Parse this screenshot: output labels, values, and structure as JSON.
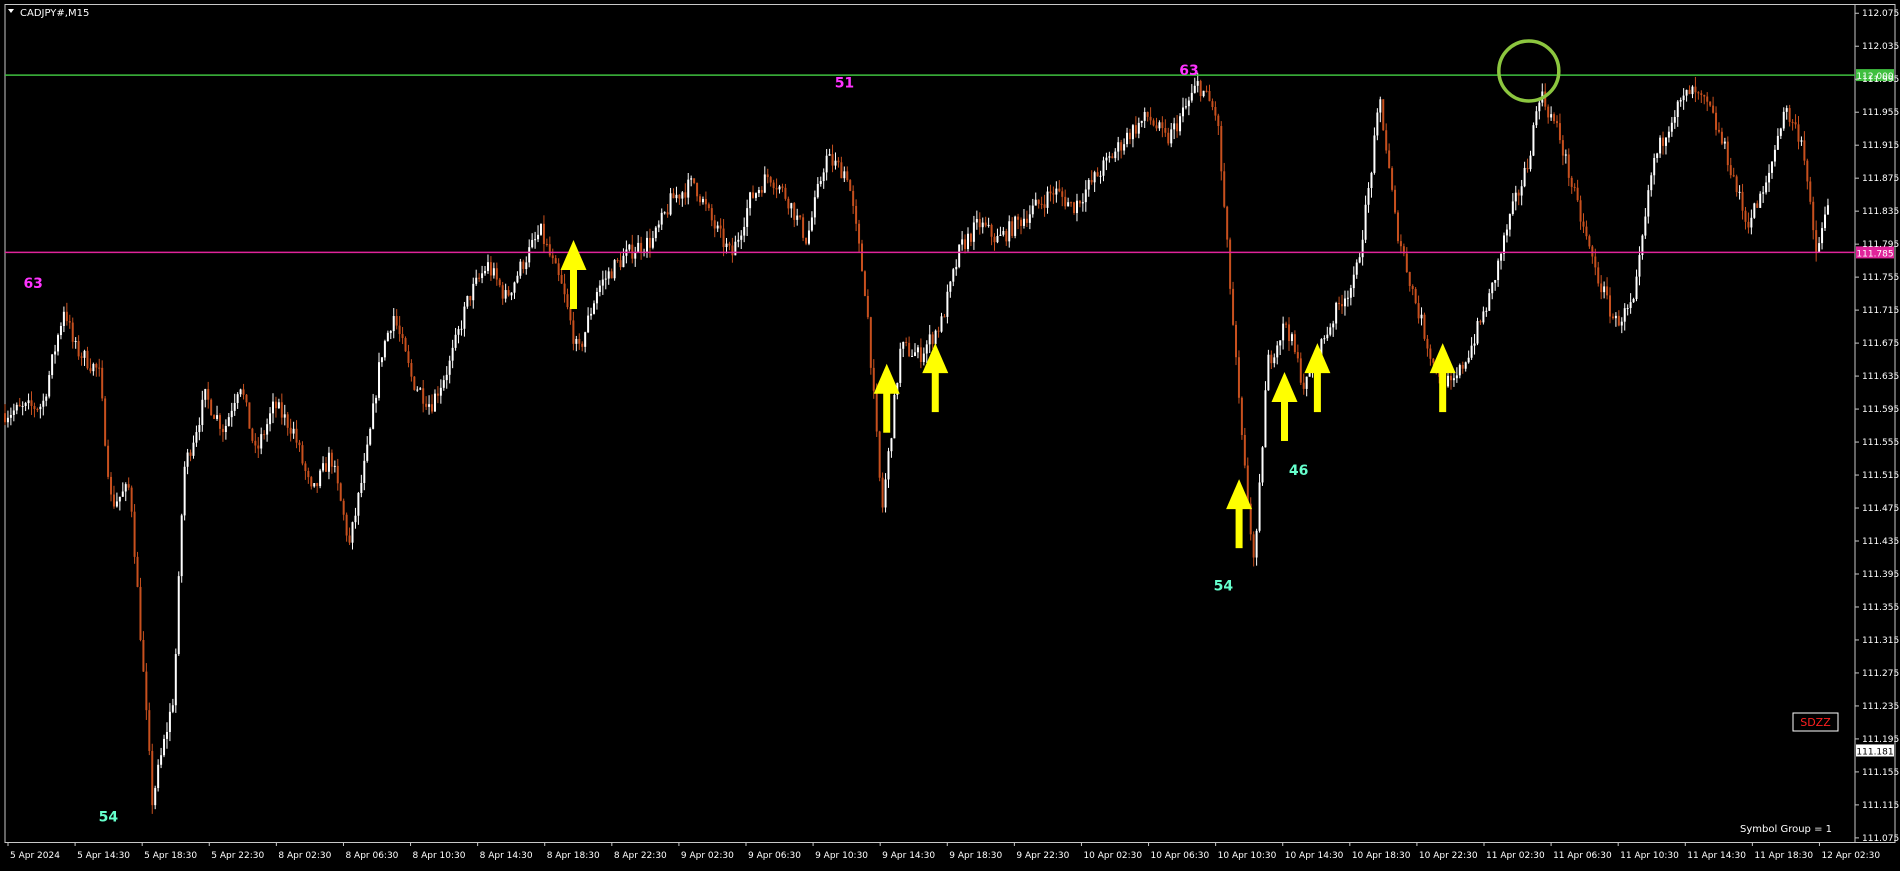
{
  "window": {
    "symbol_title": "CADJPY#,M15",
    "symbol_group": "Symbol Group = 1",
    "badge": "SDZZ"
  },
  "colors": {
    "background": "#000000",
    "bull": "#ffffff",
    "bear": "#c8501e",
    "resistance": "#3fbf3f",
    "support": "#e0249a",
    "peak_label": "#ff33ff",
    "trough_label": "#66ffcc",
    "arrow": "#ffff00",
    "circle": "#8cc63f"
  },
  "chart_data": {
    "type": "candlestick",
    "y_ticks": [
      "112.075",
      "112.035",
      "111.995",
      "111.955",
      "111.915",
      "111.875",
      "111.835",
      "111.795",
      "111.755",
      "111.715",
      "111.675",
      "111.635",
      "111.595",
      "111.555",
      "111.515",
      "111.475",
      "111.435",
      "111.395",
      "111.355",
      "111.315",
      "111.275",
      "111.235",
      "111.195",
      "111.155",
      "111.115",
      "111.075"
    ],
    "x_ticks": [
      "5 Apr 2024",
      "5 Apr 14:30",
      "5 Apr 18:30",
      "5 Apr 22:30",
      "8 Apr 02:30",
      "8 Apr 06:30",
      "8 Apr 10:30",
      "8 Apr 14:30",
      "8 Apr 18:30",
      "8 Apr 22:30",
      "9 Apr 02:30",
      "9 Apr 06:30",
      "9 Apr 10:30",
      "9 Apr 14:30",
      "9 Apr 18:30",
      "9 Apr 22:30",
      "10 Apr 02:30",
      "10 Apr 06:30",
      "10 Apr 10:30",
      "10 Apr 14:30",
      "10 Apr 18:30",
      "10 Apr 22:30",
      "11 Apr 02:30",
      "11 Apr 06:30",
      "11 Apr 10:30",
      "11 Apr 14:30",
      "11 Apr 18:30",
      "12 Apr 02:30"
    ],
    "ylim": [
      111.07,
      112.085
    ],
    "price_lines": [
      {
        "name": "resistance",
        "value": 112.0,
        "label": "112.000"
      },
      {
        "name": "support",
        "value": 111.785,
        "label": "111.785"
      }
    ],
    "current_price": {
      "value": 111.181,
      "label": "111.181"
    },
    "close_path": [
      [
        0,
        111.59
      ],
      [
        1.2,
        111.6
      ],
      [
        1.9,
        111.72
      ],
      [
        2.2,
        111.67
      ],
      [
        3.0,
        111.64
      ],
      [
        3.4,
        111.48
      ],
      [
        4.0,
        111.5
      ],
      [
        4.7,
        111.12
      ],
      [
        5.4,
        111.25
      ],
      [
        5.7,
        111.52
      ],
      [
        6.4,
        111.61
      ],
      [
        7.0,
        111.57
      ],
      [
        7.5,
        111.63
      ],
      [
        8.0,
        111.54
      ],
      [
        8.6,
        111.6
      ],
      [
        9.2,
        111.57
      ],
      [
        9.8,
        111.49
      ],
      [
        10.4,
        111.54
      ],
      [
        11.0,
        111.43
      ],
      [
        11.6,
        111.55
      ],
      [
        12.0,
        111.66
      ],
      [
        12.4,
        111.71
      ],
      [
        13.0,
        111.63
      ],
      [
        13.6,
        111.6
      ],
      [
        14.2,
        111.65
      ],
      [
        14.8,
        111.73
      ],
      [
        15.4,
        111.77
      ],
      [
        16.0,
        111.73
      ],
      [
        16.5,
        111.77
      ],
      [
        17.1,
        111.81
      ],
      [
        17.8,
        111.74
      ],
      [
        18.3,
        111.66
      ],
      [
        18.9,
        111.74
      ],
      [
        19.5,
        111.77
      ],
      [
        20.1,
        111.79
      ],
      [
        20.7,
        111.8
      ],
      [
        21.3,
        111.85
      ],
      [
        22.0,
        111.87
      ],
      [
        22.6,
        111.82
      ],
      [
        23.2,
        111.78
      ],
      [
        23.8,
        111.85
      ],
      [
        24.4,
        111.88
      ],
      [
        25.0,
        111.85
      ],
      [
        25.6,
        111.8
      ],
      [
        26.2,
        111.9
      ],
      [
        26.9,
        111.88
      ],
      [
        27.5,
        111.73
      ],
      [
        28.0,
        111.47
      ],
      [
        28.6,
        111.67
      ],
      [
        29.2,
        111.66
      ],
      [
        29.9,
        111.7
      ],
      [
        30.5,
        111.79
      ],
      [
        31.1,
        111.82
      ],
      [
        31.7,
        111.8
      ],
      [
        32.3,
        111.82
      ],
      [
        32.9,
        111.84
      ],
      [
        33.5,
        111.86
      ],
      [
        34.1,
        111.84
      ],
      [
        34.7,
        111.87
      ],
      [
        35.3,
        111.9
      ],
      [
        35.9,
        111.93
      ],
      [
        36.5,
        111.95
      ],
      [
        37.1,
        111.92
      ],
      [
        37.7,
        111.96
      ],
      [
        38.1,
        111.99
      ],
      [
        38.7,
        111.95
      ],
      [
        39.1,
        111.75
      ],
      [
        39.5,
        111.55
      ],
      [
        39.9,
        111.4
      ],
      [
        40.3,
        111.65
      ],
      [
        40.9,
        111.7
      ],
      [
        41.5,
        111.62
      ],
      [
        42.1,
        111.68
      ],
      [
        42.7,
        111.73
      ],
      [
        43.1,
        111.75
      ],
      [
        43.5,
        111.85
      ],
      [
        43.9,
        111.97
      ],
      [
        44.4,
        111.82
      ],
      [
        45.0,
        111.73
      ],
      [
        45.6,
        111.65
      ],
      [
        46.2,
        111.62
      ],
      [
        46.8,
        111.67
      ],
      [
        47.4,
        111.73
      ],
      [
        48.0,
        111.82
      ],
      [
        48.6,
        111.89
      ],
      [
        49.0,
        111.98
      ],
      [
        49.6,
        111.93
      ],
      [
        50.2,
        111.84
      ],
      [
        50.8,
        111.76
      ],
      [
        51.4,
        111.7
      ],
      [
        52.0,
        111.72
      ],
      [
        52.6,
        111.89
      ],
      [
        53.2,
        111.95
      ],
      [
        53.8,
        111.98
      ],
      [
        54.4,
        111.96
      ],
      [
        55.0,
        111.9
      ],
      [
        55.6,
        111.82
      ],
      [
        56.2,
        111.86
      ],
      [
        56.8,
        111.96
      ],
      [
        57.4,
        111.92
      ],
      [
        57.8,
        111.78
      ],
      [
        58.2,
        111.84
      ]
    ]
  },
  "annotations": {
    "swing_labels": [
      {
        "text": "63",
        "t": 0.9,
        "y": 111.742,
        "kind": "peak"
      },
      {
        "text": "54",
        "t": 3.3,
        "y": 111.095,
        "kind": "trough"
      },
      {
        "text": "51",
        "t": 26.8,
        "y": 111.985,
        "kind": "peak"
      },
      {
        "text": "63",
        "t": 37.8,
        "y": 112.0,
        "kind": "peak"
      },
      {
        "text": "54",
        "t": 38.9,
        "y": 111.375,
        "kind": "trough"
      },
      {
        "text": "46",
        "t": 41.3,
        "y": 111.515,
        "kind": "trough"
      }
    ],
    "arrows": [
      {
        "t": 18.15,
        "y": 111.8
      },
      {
        "t": 28.15,
        "y": 111.65
      },
      {
        "t": 29.7,
        "y": 111.675
      },
      {
        "t": 39.4,
        "y": 111.51
      },
      {
        "t": 40.85,
        "y": 111.64
      },
      {
        "t": 41.9,
        "y": 111.675
      },
      {
        "t": 45.9,
        "y": 111.675
      }
    ],
    "circle": {
      "t": 48.65,
      "y": 112.005
    }
  }
}
